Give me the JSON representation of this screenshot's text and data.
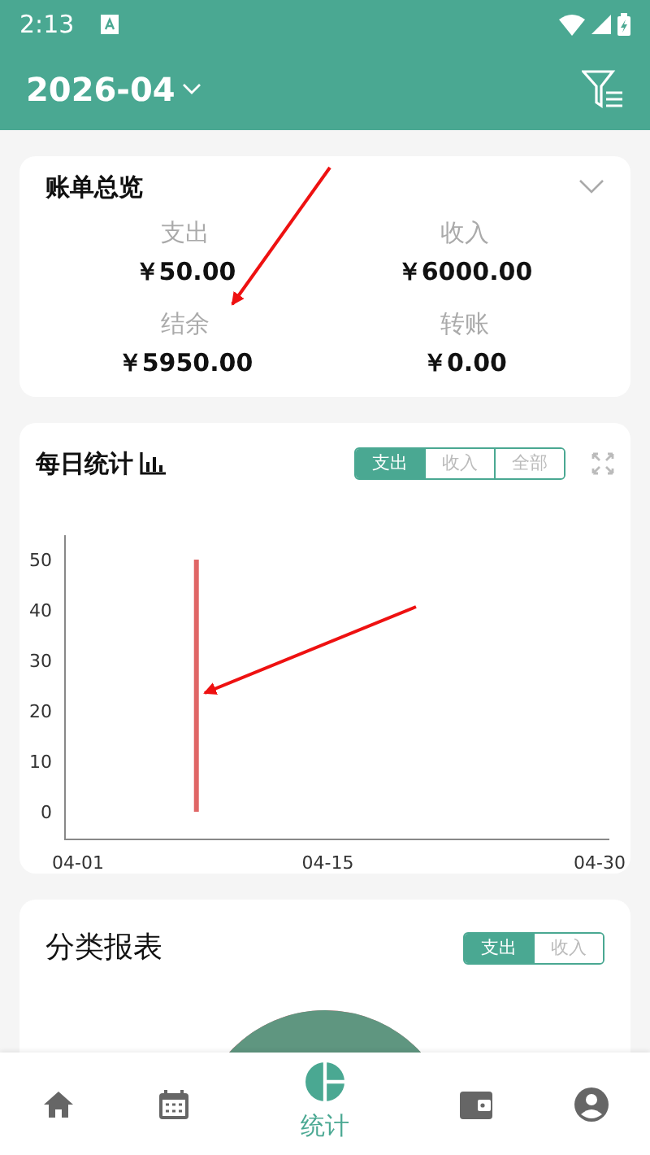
{
  "status_bar": {
    "time": "2:13"
  },
  "header": {
    "month": "2026-04"
  },
  "overview": {
    "title": "账单总览",
    "stats": [
      {
        "label": "支出",
        "value": "￥50.00"
      },
      {
        "label": "收入",
        "value": "￥6000.00"
      },
      {
        "label": "结余",
        "value": "￥5950.00"
      },
      {
        "label": "转账",
        "value": "￥0.00"
      }
    ]
  },
  "daily": {
    "title": "每日统计",
    "tabs": [
      {
        "label": "支出",
        "selected": true
      },
      {
        "label": "收入",
        "selected": false
      },
      {
        "label": "全部",
        "selected": false
      }
    ],
    "chart_data": {
      "type": "bar",
      "categories": [
        "04-01",
        null,
        null,
        null,
        null,
        null,
        null,
        null,
        null,
        null,
        null,
        null,
        null,
        null,
        "04-15",
        null,
        null,
        null,
        null,
        null,
        null,
        null,
        null,
        null,
        null,
        null,
        null,
        null,
        null,
        "04-30"
      ],
      "series": [
        {
          "color": "#e06666",
          "values": [
            0,
            0,
            0,
            0,
            0,
            0,
            0,
            50,
            0,
            0,
            0,
            0,
            0,
            0,
            0,
            0,
            0,
            0,
            0,
            0,
            0,
            0,
            0,
            0,
            0,
            0,
            0,
            0,
            0,
            0
          ]
        }
      ],
      "ylim": [
        0,
        50
      ],
      "yticks": [
        0,
        10,
        20,
        30,
        40,
        50
      ]
    }
  },
  "category": {
    "title": "分类报表",
    "tabs": [
      {
        "label": "支出",
        "selected": true
      },
      {
        "label": "收入",
        "selected": false
      }
    ]
  },
  "nav": [
    {
      "kind": "home",
      "selected": false
    },
    {
      "kind": "calendar",
      "selected": false
    },
    {
      "kind": "stats",
      "label": "统计",
      "selected": true
    },
    {
      "kind": "wallet",
      "selected": false
    },
    {
      "kind": "profile",
      "selected": false
    }
  ]
}
